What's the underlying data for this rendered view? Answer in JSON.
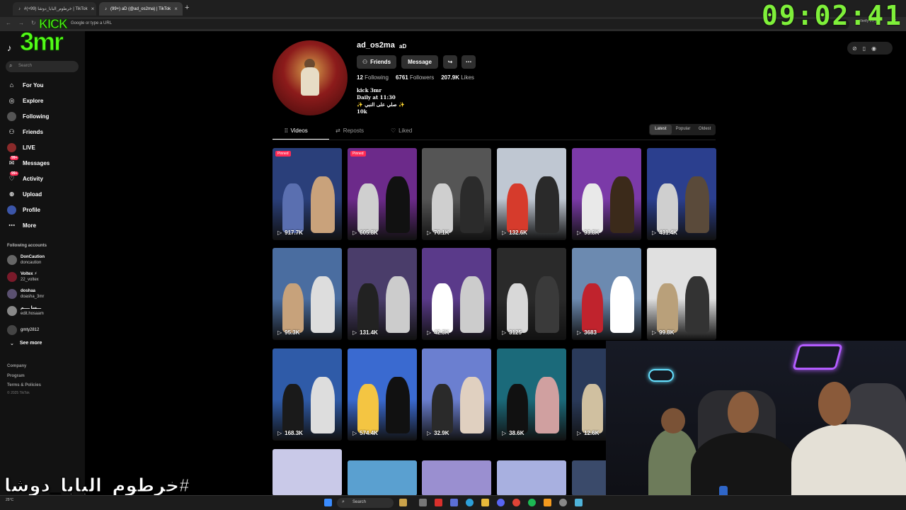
{
  "browser": {
    "tabs": [
      {
        "label": "#خرطوم_البابا_دوشا (99+) | TikTok"
      },
      {
        "label": "(99+) aD (@ad_os2ma) | TikTok"
      }
    ],
    "new_tab": "+",
    "address_placeholder": "Google or type a URL",
    "verify_text": "Verify it's you",
    "close_glyph": "×"
  },
  "overlay": {
    "clock": "09:02:41",
    "kick_top": "KICK",
    "kick_bottom": "3mr",
    "hashtag": "#خرطوم_البابا_دوشا"
  },
  "sidebar": {
    "search_placeholder": "Search",
    "items": [
      {
        "label": "For You",
        "icon": "home-icon"
      },
      {
        "label": "Explore",
        "icon": "compass-icon"
      },
      {
        "label": "Following",
        "icon": "following-avatar-icon"
      },
      {
        "label": "Friends",
        "icon": "friends-icon"
      },
      {
        "label": "LIVE",
        "icon": "live-icon"
      },
      {
        "label": "Messages",
        "icon": "messages-icon",
        "badge": "99+"
      },
      {
        "label": "Activity",
        "icon": "activity-icon",
        "badge": "99+"
      },
      {
        "label": "Upload",
        "icon": "upload-icon"
      },
      {
        "label": "Profile",
        "icon": "profile-icon"
      },
      {
        "label": "More",
        "icon": "more-icon"
      }
    ],
    "following_title": "Following accounts",
    "accounts": [
      {
        "name": "DonCaution",
        "handle": "doncaution"
      },
      {
        "name": "Voltex ⚡",
        "handle": "22_voltex"
      },
      {
        "name": "doshaa",
        "handle": "doasha_3mr"
      },
      {
        "name": "ـــسا ــــم",
        "handle": "edit.hosaam"
      },
      {
        "name": "gmty2812",
        "handle": ""
      }
    ],
    "see_more": "See more",
    "footer": [
      "Company",
      "Program",
      "Terms & Policies"
    ],
    "copyright": "© 2025 TikTok"
  },
  "profile": {
    "username": "ad_os2ma",
    "nickname": "aD",
    "buttons": {
      "friends": "Friends",
      "message": "Message"
    },
    "stats": {
      "following_count": "12",
      "following_label": "Following",
      "followers_count": "6761",
      "followers_label": "Followers",
      "likes_count": "207.9K",
      "likes_label": "Likes"
    },
    "bio": [
      "kick 3mr",
      "Daily at 11:30",
      "✨ صلي على النبي ✨",
      "10k"
    ],
    "tabs": [
      {
        "label": "Videos"
      },
      {
        "label": "Reposts"
      },
      {
        "label": "Liked"
      }
    ],
    "sort": [
      "Latest",
      "Popular",
      "Oldest"
    ]
  },
  "videos": [
    {
      "views": "917.7K",
      "pinned": "Pinned"
    },
    {
      "views": "605.8K",
      "pinned": "Pinned"
    },
    {
      "views": "70.1K"
    },
    {
      "views": "132.6K"
    },
    {
      "views": "93.8K"
    },
    {
      "views": "431.4K"
    },
    {
      "views": "95.3K"
    },
    {
      "views": "131.4K"
    },
    {
      "views": "42.3K"
    },
    {
      "views": "3125"
    },
    {
      "views": "3683"
    },
    {
      "views": "99.8K"
    },
    {
      "views": "168.3K"
    },
    {
      "views": "574.4K"
    },
    {
      "views": "32.9K"
    },
    {
      "views": "38.6K"
    },
    {
      "views": "12.6K"
    }
  ],
  "taskbar": {
    "search": "Search",
    "weather": "25°C"
  },
  "colors": {
    "accent": "#fe2c55",
    "kick_green": "#53fc18",
    "clock_green": "#7ff03a"
  }
}
